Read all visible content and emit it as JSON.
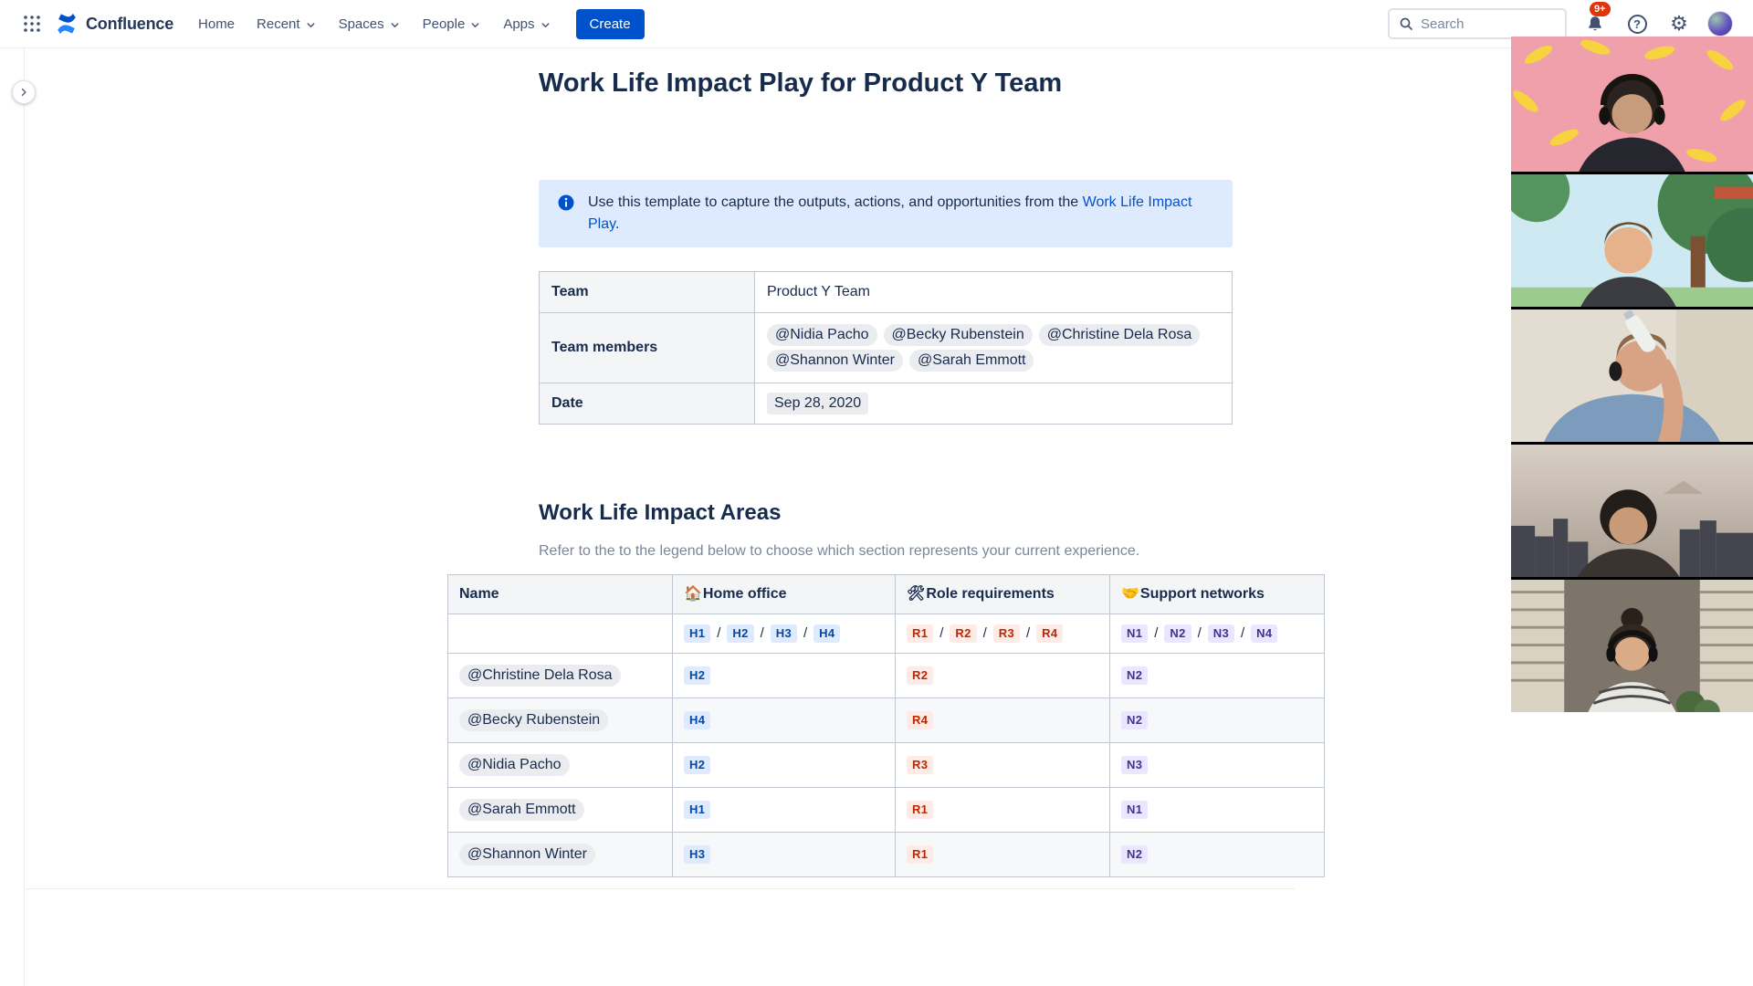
{
  "topbar": {
    "brand": "Confluence",
    "nav": [
      {
        "label": "Home",
        "dropdown": false
      },
      {
        "label": "Recent",
        "dropdown": true
      },
      {
        "label": "Spaces",
        "dropdown": true
      },
      {
        "label": "People",
        "dropdown": true
      },
      {
        "label": "Apps",
        "dropdown": true
      }
    ],
    "create_label": "Create",
    "search_placeholder": "Search",
    "notification_badge": "9+",
    "help_glyph": "?"
  },
  "page": {
    "title": "Work Life Impact Play for Product Y Team",
    "info_panel": {
      "text_before_link": "Use this template to capture the outputs, actions, and opportunities from the ",
      "link_text": "Work Life Impact Play",
      "text_after_link": "."
    },
    "team_table": {
      "rows": [
        {
          "label": "Team",
          "type": "text",
          "value": "Product Y Team"
        },
        {
          "label": "Team members",
          "type": "mentions",
          "mentions": [
            "@Nidia Pacho",
            "@Becky Rubenstein",
            "@Christine Dela Rosa",
            "@Shannon Winter",
            "@Sarah Emmott"
          ]
        },
        {
          "label": "Date",
          "type": "date",
          "value": "Sep 28, 2020"
        }
      ]
    },
    "section": {
      "heading": "Work Life Impact Areas",
      "subtext": "Refer to the to the legend below to choose which section represents your current experience."
    },
    "impact_table": {
      "headers": [
        {
          "emoji": "",
          "label": "Name",
          "icon": ""
        },
        {
          "emoji": "🏠",
          "label": "Home office",
          "icon": "home-emoji-icon"
        },
        {
          "emoji": "🛠",
          "label": "Role requirements",
          "icon": "tools-emoji-icon"
        },
        {
          "emoji": "🤝",
          "label": "Support networks",
          "icon": "handshake-emoji-icon"
        }
      ],
      "legend_separator": "/",
      "legend": {
        "home": [
          "H1",
          "H2",
          "H3",
          "H4"
        ],
        "role": [
          "R1",
          "R2",
          "R3",
          "R4"
        ],
        "support": [
          "N1",
          "N2",
          "N3",
          "N4"
        ]
      },
      "rows": [
        {
          "name": "@Christine Dela Rosa",
          "home": "H2",
          "role": "R2",
          "support": "N2"
        },
        {
          "name": "@Becky Rubenstein",
          "home": "H4",
          "role": "R4",
          "support": "N2"
        },
        {
          "name": "@Nidia Pacho",
          "home": "H2",
          "role": "R3",
          "support": "N3"
        },
        {
          "name": "@Sarah Emmott",
          "home": "H1",
          "role": "R1",
          "support": "N1"
        },
        {
          "name": "@Shannon Winter",
          "home": "H3",
          "role": "R1",
          "support": "N2"
        }
      ]
    }
  },
  "video_strip": {
    "participants": [
      {
        "description": "participant with headphones, banana pattern background"
      },
      {
        "description": "participant with illustrated tree background"
      },
      {
        "description": "participant drinking from a water bottle"
      },
      {
        "description": "participant with city skyline background"
      },
      {
        "description": "participant with headphones between window blinds"
      }
    ]
  },
  "colors": {
    "brand_blue": "#0052CC",
    "info_panel_bg": "#DEEBFF",
    "lozenge_blue_bg": "#DEEBFF",
    "lozenge_blue_text": "#0747A6",
    "lozenge_red_bg": "#FFEBE6",
    "lozenge_red_text": "#BF2600",
    "lozenge_purple_bg": "#EAE6FF",
    "lozenge_purple_text": "#403294",
    "badge_red": "#DE350B"
  }
}
